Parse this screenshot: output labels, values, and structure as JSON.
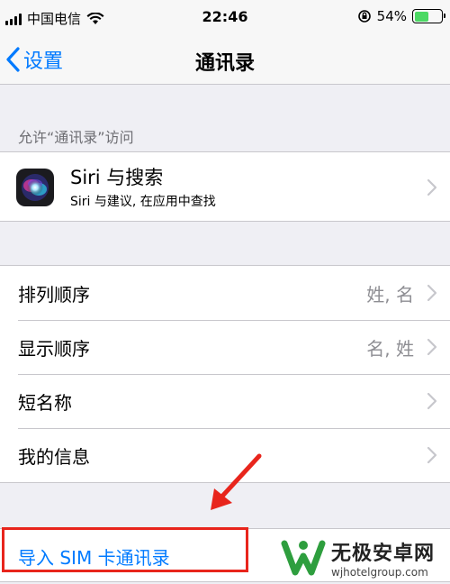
{
  "status_bar": {
    "carrier": "中国电信",
    "time": "22:46",
    "battery_percent": "54%",
    "battery_level": 0.54
  },
  "nav": {
    "back_label": "设置",
    "title": "通讯录"
  },
  "section_header": "允许“通讯录”访问",
  "siri": {
    "title": "Siri 与搜索",
    "subtitle": "Siri 与建议, 在应用中查找"
  },
  "settings_rows": [
    {
      "label": "排列顺序",
      "value": "姓, 名"
    },
    {
      "label": "显示顺序",
      "value": "名, 姓"
    },
    {
      "label": "短名称",
      "value": ""
    },
    {
      "label": "我的信息",
      "value": ""
    }
  ],
  "import_label": "导入 SIM 卡通讯录",
  "watermark": {
    "title": "无极安卓网",
    "url": "wjhotelgroup.com"
  },
  "colors": {
    "accent": "#007aff",
    "annotation": "#e8251c",
    "battery": "#4cd964"
  }
}
